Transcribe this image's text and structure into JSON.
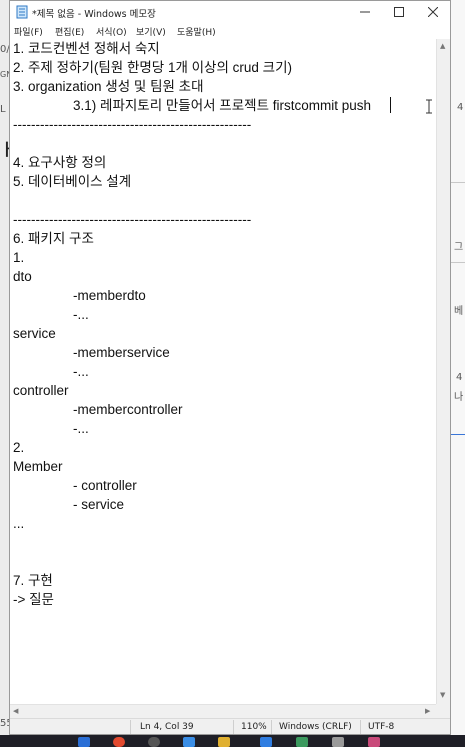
{
  "window": {
    "title": "*제목 없음 - Windows 메모장",
    "controls": [
      "minimize",
      "maximize",
      "close"
    ]
  },
  "menu": [
    "파일(F)",
    "편집(E)",
    "서식(O)",
    "보기(V)",
    "도움말(H)"
  ],
  "editor": {
    "lines": [
      "1. 코드컨벤션 정해서 숙지",
      "2. 주제 정하기(팀원 한명당 1개 이상의 crud 크기)",
      "3. organization 생성 및 팀원 초대",
      "                3.1) 레파지토리 만들어서 프로젝트 firstcommit push",
      "-----------------------------------------------------",
      "",
      "4. 요구사항 정의",
      "5. 데이터베이스 설계",
      "",
      "-----------------------------------------------------",
      "6. 패키지 구조",
      "1.",
      "dto",
      "                -memberdto",
      "                -...",
      "service",
      "                -memberservice",
      "                -...",
      "controller",
      "                -membercontroller",
      "                -...",
      "2.",
      "Member",
      "                - controller",
      "                - service",
      "...",
      "",
      "",
      "7. 구현",
      "-> 질문"
    ]
  },
  "status": {
    "position": "Ln 4, Col 39",
    "zoom": "110%",
    "line_ending": "Windows (CRLF)",
    "encoding": "UTF-8"
  },
  "background_app": {
    "fragments": [
      "0/",
      "GN",
      "L",
      "ㅏ",
      "4",
      "그",
      "베",
      "4",
      "나",
      "55"
    ]
  }
}
